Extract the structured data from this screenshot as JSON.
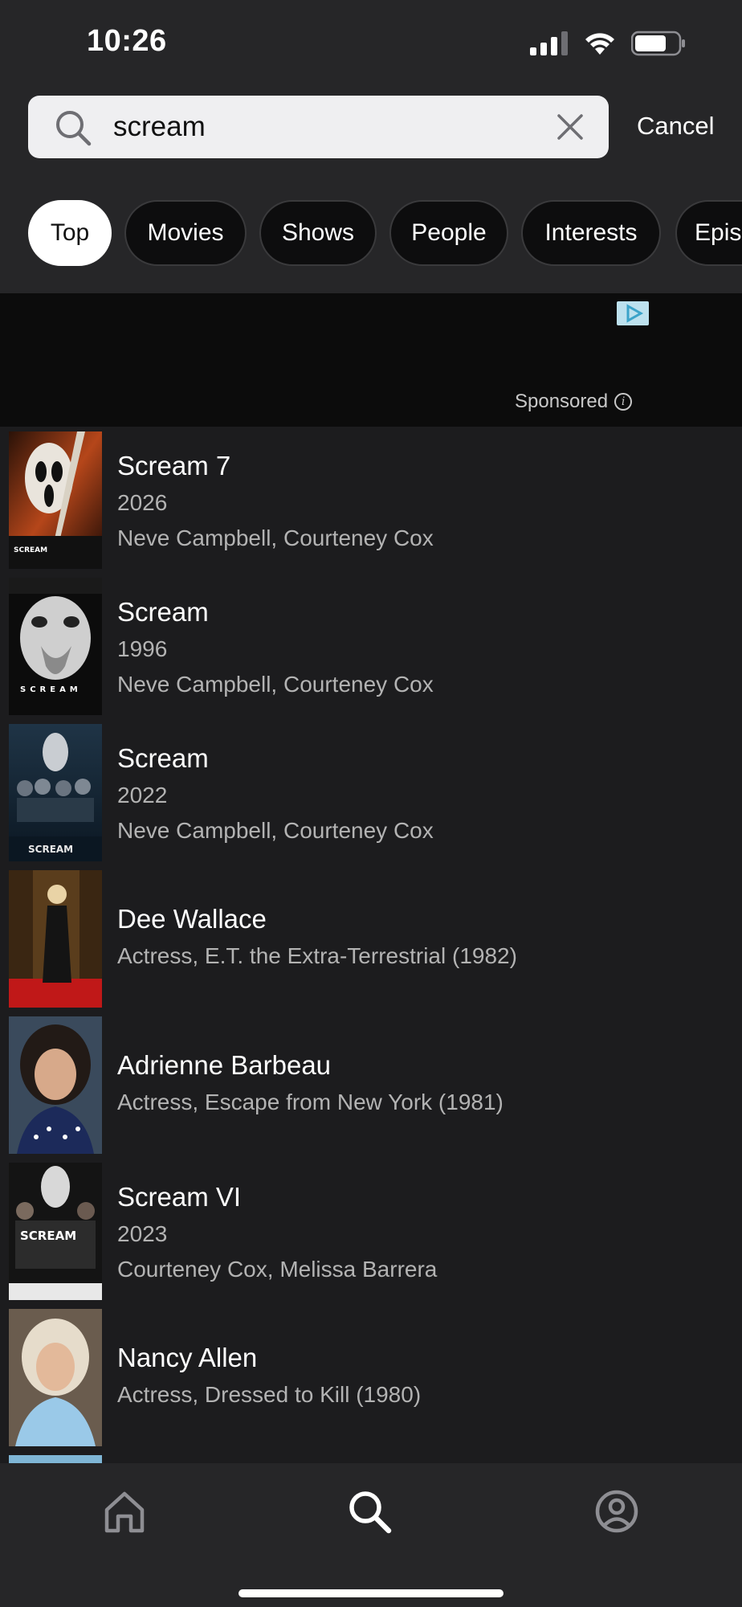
{
  "status": {
    "time": "10:26"
  },
  "search": {
    "query": "scream",
    "cancel_label": "Cancel"
  },
  "filters": [
    {
      "label": "Top",
      "active": true
    },
    {
      "label": "Movies",
      "active": false
    },
    {
      "label": "Shows",
      "active": false
    },
    {
      "label": "People",
      "active": false
    },
    {
      "label": "Interests",
      "active": false
    },
    {
      "label": "Episodes",
      "active": false
    }
  ],
  "ad": {
    "sponsored_label": "Sponsored"
  },
  "results": [
    {
      "title": "Scream 7",
      "line1": "2026",
      "line2": "Neve Campbell, Courteney Cox",
      "poster_text": "SCREAM"
    },
    {
      "title": "Scream",
      "line1": "1996",
      "line2": "Neve Campbell, Courteney Cox",
      "poster_text": "SCREAM"
    },
    {
      "title": "Scream",
      "line1": "2022",
      "line2": "Neve Campbell, Courteney Cox",
      "poster_text": "SCREAM"
    },
    {
      "title": "Dee Wallace",
      "line1": "Actress, E.T. the Extra-Terrestrial (1982)"
    },
    {
      "title": "Adrienne Barbeau",
      "line1": "Actress, Escape from New York (1981)"
    },
    {
      "title": "Scream VI",
      "line1": "2023",
      "line2": "Courteney Cox, Melissa Barrera",
      "poster_text": "SCREAM"
    },
    {
      "title": "Nancy Allen",
      "line1": "Actress, Dressed to Kill (1980)"
    }
  ],
  "nav": {
    "items": [
      "home-icon",
      "search-icon",
      "profile-icon"
    ]
  },
  "colors": {
    "background": "#1c1c1e",
    "bar": "#262628",
    "chip_active": "#ffffff",
    "subtext": "#b3b3b3"
  }
}
